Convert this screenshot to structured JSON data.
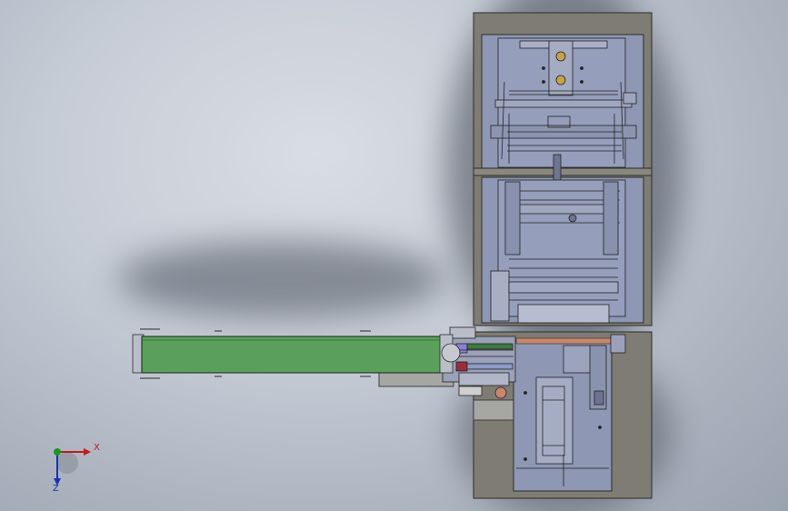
{
  "app": {
    "view": "CAD top view"
  },
  "colors": {
    "background": "#c6ccd6",
    "frame": "#7f7c73",
    "panel": "#8e97b3",
    "conveyor_belt": "#5aa05a",
    "axis_x": "#c21a1a",
    "axis_y": "#1a9a1a",
    "axis_z": "#1a2fb8"
  },
  "triad": {
    "x_label": "X",
    "z_label": "Z"
  }
}
